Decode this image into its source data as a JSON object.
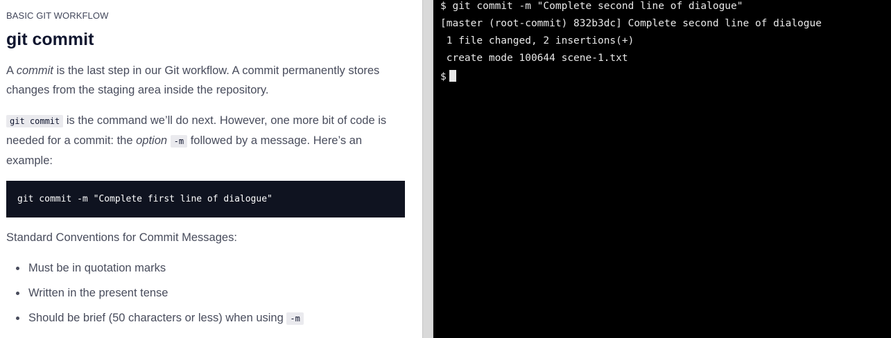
{
  "lesson": {
    "section_label": "BASIC GIT WORKFLOW",
    "title": "git commit",
    "p1": {
      "t1": "A ",
      "em1": "commit",
      "t2": " is the last step in our Git workflow. A commit permanently stores changes from the staging area inside the repository."
    },
    "p2": {
      "code1": "git commit",
      "t1": " is the command we’ll do next. However, one more bit of code is needed for a commit: the ",
      "em1": "option",
      "t2": " ",
      "code2": "-m",
      "t3": " followed by a message. Here’s an example:"
    },
    "code_block": "git commit -m \"Complete first line of dialogue\"",
    "p4": "Standard Conventions for Commit Messages:",
    "bullets": [
      {
        "text": "Must be in quotation marks"
      },
      {
        "text": "Written in the present tense"
      },
      {
        "text": "Should be brief (50 characters or less) when using ",
        "code": "-m"
      }
    ]
  },
  "terminal": {
    "lines": [
      "$ git commit -m \"Complete second line of dialogue\"",
      "[master (root-commit) 832b3dc] Complete second line of dialogue",
      " 1 file changed, 2 insertions(+)",
      " create mode 100644 scene-1.txt"
    ],
    "prompt": "$"
  },
  "colors": {
    "terminal_bg": "#000000",
    "terminal_text": "#e8e8e8",
    "code_block_bg": "#0f1320",
    "heading": "#10162f",
    "body_text": "#484c5c"
  }
}
